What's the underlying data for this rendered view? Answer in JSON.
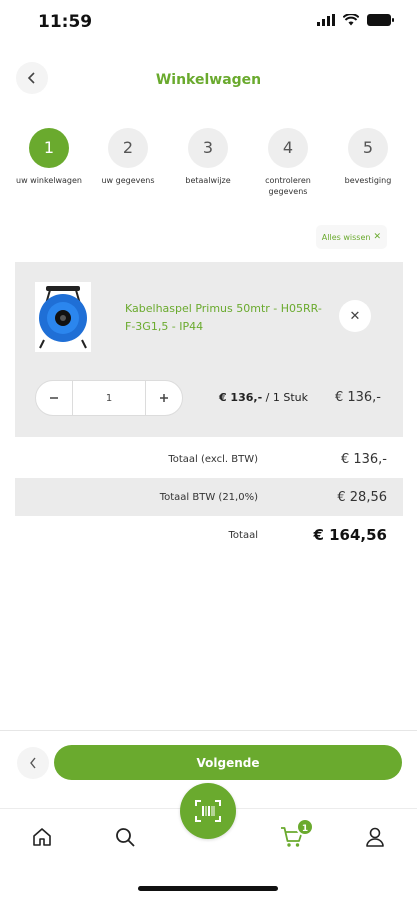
{
  "status_bar": {
    "time": "11:59"
  },
  "header": {
    "title": "Winkelwagen"
  },
  "steps": [
    {
      "number": "1",
      "label": "uw winkelwagen",
      "active": true
    },
    {
      "number": "2",
      "label": "uw gegevens",
      "active": false
    },
    {
      "number": "3",
      "label": "betaalwijze",
      "active": false
    },
    {
      "number": "4",
      "label": "controleren gegevens",
      "active": false
    },
    {
      "number": "5",
      "label": "bevestiging",
      "active": false
    }
  ],
  "cart": {
    "clear_label": "Alles wissen",
    "item": {
      "name": "Kabelhaspel Primus 50mtr - H05RR-F-3G1,5 - IP44",
      "quantity": "1",
      "unit_price": "€ 136,-",
      "unit_suffix": "/ 1 Stuk",
      "line_total": "€ 136,-"
    }
  },
  "totals": {
    "excl_label": "Totaal (excl. BTW)",
    "excl_value": "€ 136,-",
    "vat_label": "Totaal BTW (21,0%)",
    "vat_value": "€ 28,56",
    "grand_label": "Totaal",
    "grand_value": "€ 164,56"
  },
  "footer": {
    "next_label": "Volgende"
  },
  "tabbar": {
    "cart_badge": "1"
  },
  "colors": {
    "accent": "#6aaa2e",
    "panel": "#ebebeb"
  }
}
